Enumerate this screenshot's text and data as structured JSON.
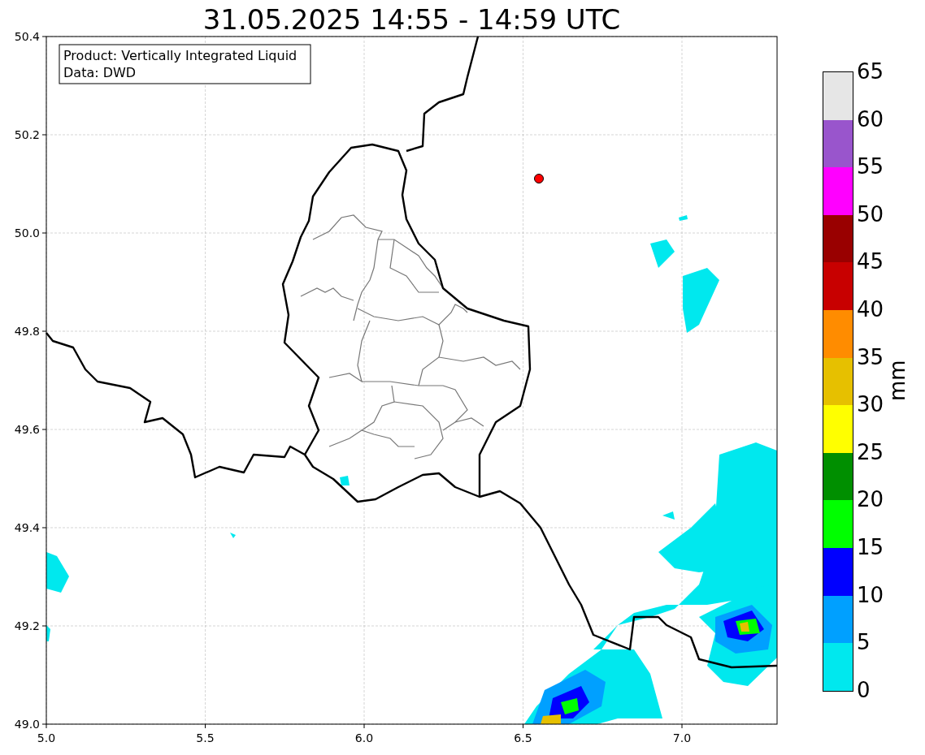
{
  "title": "31.05.2025 14:55 - 14:59 UTC",
  "map": {
    "xticks": [
      "5.0",
      "5.5",
      "6.0",
      "6.5",
      "7.0"
    ],
    "yticks": [
      "50.4",
      "50.2",
      "50.0",
      "49.8",
      "49.6",
      "49.4",
      "49.2",
      "49.0"
    ]
  },
  "legend": {
    "lines": [
      "Product: Vertically Integrated Liquid",
      "Data: DWD"
    ]
  },
  "colorbar": {
    "label": "mm",
    "ticks": [
      "65",
      "60",
      "55",
      "50",
      "45",
      "40",
      "35",
      "30",
      "25",
      "20",
      "15",
      "10",
      "5",
      "0"
    ],
    "bands": [
      {
        "color": "#e6e6e6"
      },
      {
        "color": "#9955cc"
      },
      {
        "color": "#ff00ff"
      },
      {
        "color": "#990000"
      },
      {
        "color": "#c80000"
      },
      {
        "color": "#ff8c00"
      },
      {
        "color": "#e6c000"
      },
      {
        "color": "#ffff00"
      },
      {
        "color": "#008f00"
      },
      {
        "color": "#00ff00"
      },
      {
        "color": "#0000ff"
      },
      {
        "color": "#00a0ff"
      },
      {
        "color": "#00e8ee"
      }
    ]
  }
}
